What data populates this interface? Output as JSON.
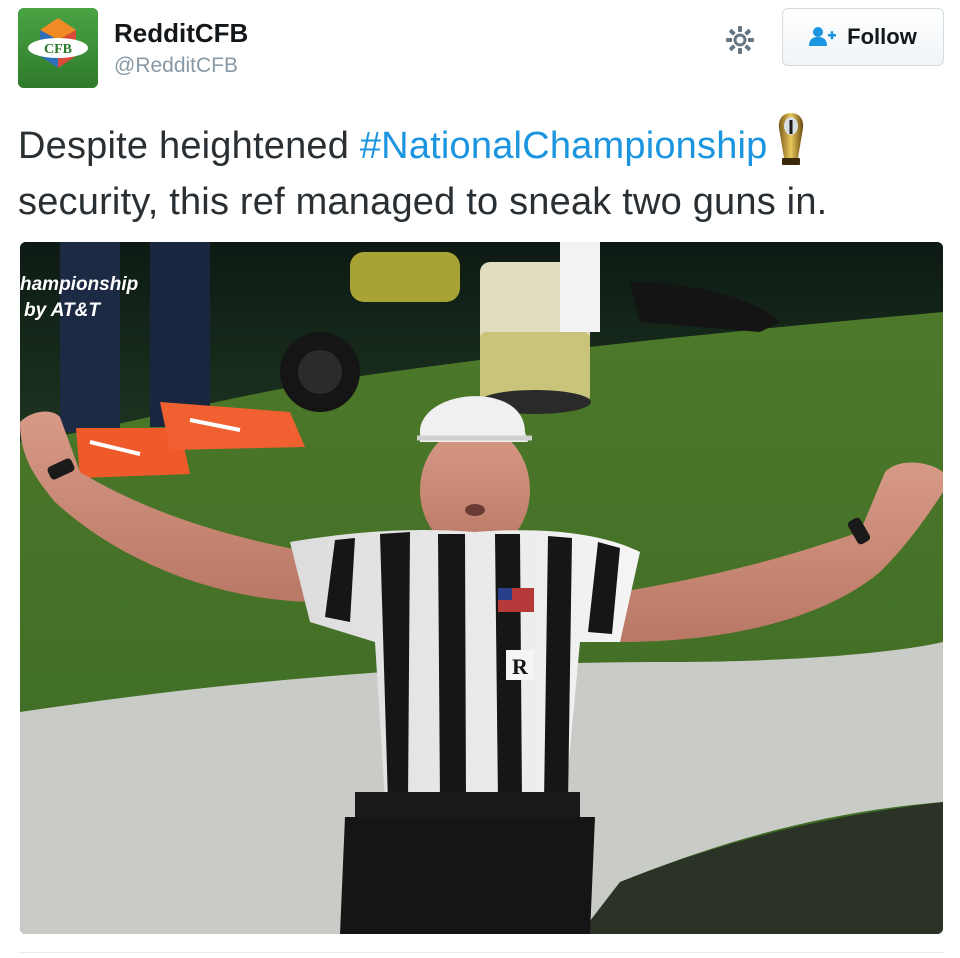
{
  "user": {
    "display_name": "RedditCFB",
    "handle": "@RedditCFB",
    "avatar_text": "CFB"
  },
  "actions": {
    "settings_icon": "gear-icon",
    "follow_label": "Follow",
    "follow_icon": "add-user-icon"
  },
  "tweet": {
    "text_before_hashtag": "Despite heightened ",
    "hashtag": "#NationalChampionship",
    "text_after_hashtag": "security, this ref managed to sneak two guns in.",
    "emoji": "trophy-icon"
  },
  "media": {
    "overlay_line1": "hampionship",
    "overlay_line2": "by AT&T",
    "badge_letter": "R"
  },
  "colors": {
    "link": "#1b95e0",
    "text": "#292f33",
    "secondary": "#8899a6"
  }
}
